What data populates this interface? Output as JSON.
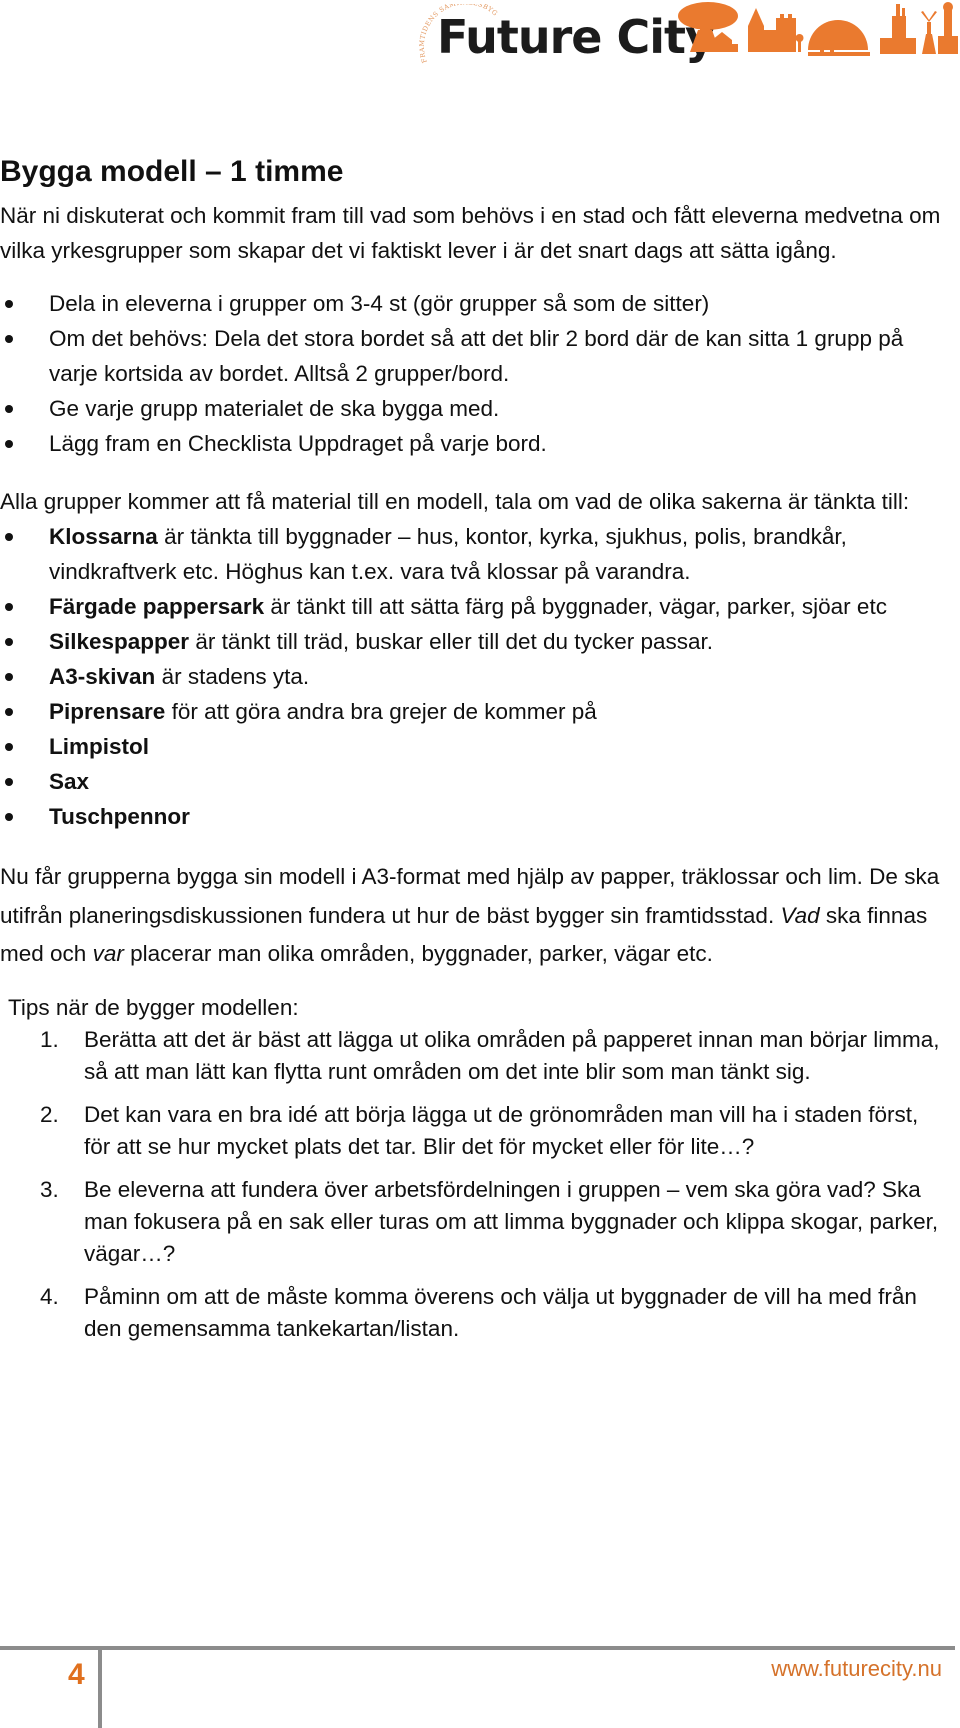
{
  "header": {
    "logo": {
      "wordmark": "Future City",
      "tagline": "FRAMTIDENS SAMHÄLLSBYGGARE",
      "brand_color": "#ea7a2f",
      "text_color": "#1c1c1c"
    }
  },
  "section": {
    "title": "Bygga modell – 1 timme",
    "intro": "När ni diskuterat och kommit fram till vad som behövs i en stad och fått eleverna medvetna om vilka yrkesgrupper som skapar det vi faktiskt lever i är det snart dags att sätta igång.",
    "steps": [
      "Dela in eleverna i grupper om 3-4 st (gör grupper så som de sitter)",
      "Om det behövs: Dela det stora bordet så att det blir 2 bord där de kan sitta 1 grupp på varje kortsida av bordet. Alltså 2 grupper/bord.",
      "Ge varje grupp materialet de ska bygga med.",
      "Lägg fram en Checklista Uppdraget på varje bord."
    ],
    "materials_intro": "Alla grupper kommer att få material till en modell, tala om vad de olika sakerna är tänkta till:",
    "materials": [
      {
        "name": "Klossarna",
        "desc": " är tänkta till byggnader – hus, kontor, kyrka, sjukhus, polis, brandkår, vindkraftverk etc. Höghus kan t.ex. vara två klossar på varandra."
      },
      {
        "name": "Färgade pappersark",
        "desc": " är tänkt till att sätta färg på byggnader, vägar, parker, sjöar etc"
      },
      {
        "name": "Silkespapper",
        "desc": " är tänkt till träd, buskar eller till det du tycker passar."
      },
      {
        "name": "A3-skivan",
        "desc": " är stadens yta."
      },
      {
        "name": "Piprensare",
        "desc": " för att göra andra bra grejer de kommer på"
      },
      {
        "name": "Limpistol",
        "desc": ""
      },
      {
        "name": "Sax",
        "desc": ""
      },
      {
        "name": "Tuschpennor",
        "desc": ""
      }
    ],
    "build_paragraph": {
      "part1": "Nu får grupperna bygga sin modell i A3-format med hjälp av papper, träklossar och lim. De ska utifrån planeringsdiskussionen fundera ut hur de bäst bygger sin framtidsstad. ",
      "em1": "Vad",
      "part2": " ska finnas med och ",
      "em2": "var",
      "part3": " placerar man olika områden, byggnader, parker, vägar etc."
    },
    "tips_label": "Tips när de bygger modellen:",
    "tips": [
      {
        "num": "1.",
        "text": "Berätta att det är bäst att lägga ut olika områden på papperet innan man börjar limma, så att man lätt kan flytta runt områden om det inte blir som man tänkt sig."
      },
      {
        "num": "2.",
        "text": "Det kan vara en bra idé att börja lägga ut de grönområden man vill ha i staden först, för att se hur mycket plats det tar. Blir det för mycket eller för lite…?"
      },
      {
        "num": "3.",
        "text": "Be eleverna att fundera över arbetsfördelningen i gruppen – vem ska göra vad? Ska man fokusera på en sak eller turas om att limma byggnader och klippa skogar, parker, vägar…?"
      },
      {
        "num": "4.",
        "text": "Påminn om att de måste komma överens och välja ut byggnader de vill ha med från den gemensamma tankekartan/listan."
      }
    ]
  },
  "footer": {
    "page_number": "4",
    "url": "www.futurecity.nu",
    "accent_color": "#e0701e"
  }
}
